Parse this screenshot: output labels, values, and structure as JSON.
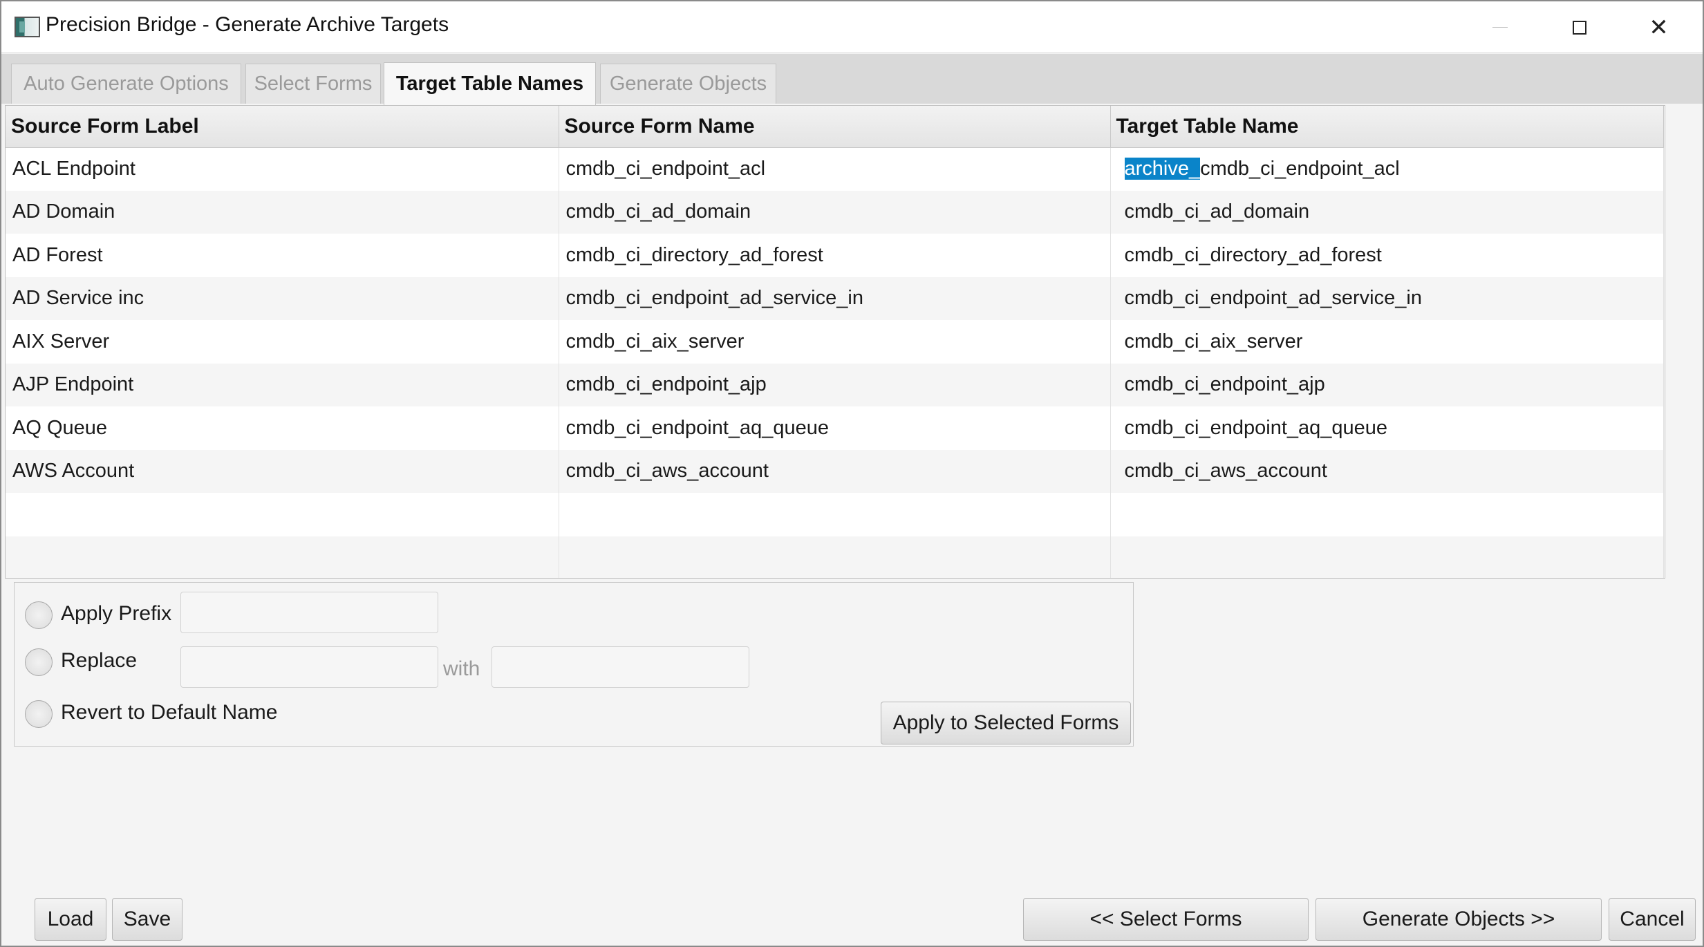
{
  "window": {
    "title": "Precision Bridge - Generate Archive Targets"
  },
  "tabs": [
    {
      "label": "Auto Generate Options",
      "active": false
    },
    {
      "label": "Select Forms",
      "active": false
    },
    {
      "label": "Target Table Names",
      "active": true
    },
    {
      "label": "Generate Objects",
      "active": false
    }
  ],
  "table": {
    "columns": [
      "Source Form Label",
      "Source Form Name",
      "Target Table Name"
    ],
    "rows": [
      {
        "label": "ACL Endpoint",
        "name": "cmdb_ci_endpoint_acl",
        "target_selected": "archive_",
        "target": "cmdb_ci_endpoint_acl"
      },
      {
        "label": "AD Domain",
        "name": "cmdb_ci_ad_domain",
        "target": "cmdb_ci_ad_domain"
      },
      {
        "label": "AD Forest",
        "name": "cmdb_ci_directory_ad_forest",
        "target": "cmdb_ci_directory_ad_forest"
      },
      {
        "label": "AD Service inc",
        "name": "cmdb_ci_endpoint_ad_service_in",
        "target": "cmdb_ci_endpoint_ad_service_in"
      },
      {
        "label": "AIX Server",
        "name": "cmdb_ci_aix_server",
        "target": "cmdb_ci_aix_server"
      },
      {
        "label": "AJP Endpoint",
        "name": "cmdb_ci_endpoint_ajp",
        "target": "cmdb_ci_endpoint_ajp"
      },
      {
        "label": "AQ Queue",
        "name": "cmdb_ci_endpoint_aq_queue",
        "target": "cmdb_ci_endpoint_aq_queue"
      },
      {
        "label": "AWS Account",
        "name": "cmdb_ci_aws_account",
        "target": "cmdb_ci_aws_account"
      }
    ]
  },
  "options": {
    "apply_prefix_label": "Apply Prefix",
    "prefix_value": "",
    "replace_label": "Replace",
    "replace_value": "",
    "with_label": "with",
    "with_value": "",
    "revert_label": "Revert to Default Name",
    "apply_button": "Apply to Selected Forms"
  },
  "footer": {
    "load": "Load",
    "save": "Save",
    "prev": "<< Select Forms",
    "next": "Generate Objects >>",
    "cancel": "Cancel"
  },
  "colors": {
    "selection": "#0a84c9"
  }
}
